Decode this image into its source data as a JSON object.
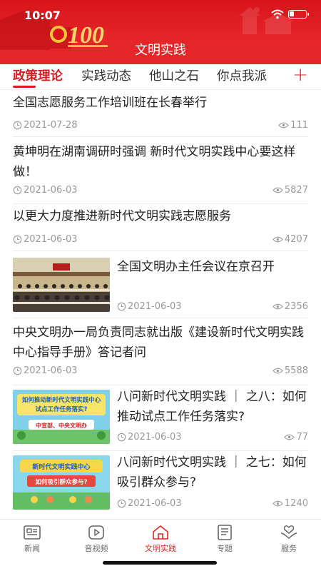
{
  "status_bar": {
    "time": "10:07"
  },
  "header": {
    "title": "文明实践"
  },
  "tabs": [
    {
      "label": "政策理论",
      "active": true
    },
    {
      "label": "实践动态",
      "active": false
    },
    {
      "label": "他山之石",
      "active": false
    },
    {
      "label": "你点我派",
      "active": false
    }
  ],
  "tab_add_label": "+",
  "news": [
    {
      "title": "全国志愿服务工作培训班在长春举行",
      "date": "2021-07-28",
      "views": "111"
    },
    {
      "title": "黄坤明在湖南调研时强调 新时代文明实践中心要这样做！",
      "date": "2021-06-03",
      "views": "5827"
    },
    {
      "title": "以更大力度推进新时代文明实践志愿服务",
      "date": "2021-06-03",
      "views": "4207"
    },
    {
      "title": "全国文明办主任会议在京召开",
      "date": "2021-06-03",
      "views": "2356",
      "thumb": "meeting-photo"
    },
    {
      "title": "中央文明办一局负责同志就出版《建设新时代文明实践中心指导手册》答记者问",
      "date": "2021-06-03",
      "views": "5588"
    },
    {
      "title": "八问新时代文明实践 ｜ 之八：如何推动试点工作任务落实?",
      "date": "2021-06-03",
      "views": "77",
      "thumb": "poster-8",
      "thumb_text": [
        "如何推动新时代文明实践中心",
        "试点工作任务落实?",
        "中宣部、中央文明办"
      ]
    },
    {
      "title": "八问新时代文明实践 ｜ 之七：如何吸引群众参与?",
      "date": "2021-06-03",
      "views": "1240",
      "thumb": "poster-7",
      "thumb_text": [
        "新时代文明实践中心",
        "如何吸引群众参与?"
      ]
    }
  ],
  "bottom_nav": [
    {
      "label": "新闻",
      "icon": "news-icon",
      "active": false
    },
    {
      "label": "音视频",
      "icon": "video-icon",
      "active": false
    },
    {
      "label": "文明实践",
      "icon": "home-icon",
      "active": true
    },
    {
      "label": "专题",
      "icon": "topic-icon",
      "active": false
    },
    {
      "label": "服务",
      "icon": "service-icon",
      "active": false
    }
  ],
  "colors": {
    "brand_red": "#d81c21",
    "nav_active": "#e0271f",
    "meta_gray": "#999999"
  }
}
